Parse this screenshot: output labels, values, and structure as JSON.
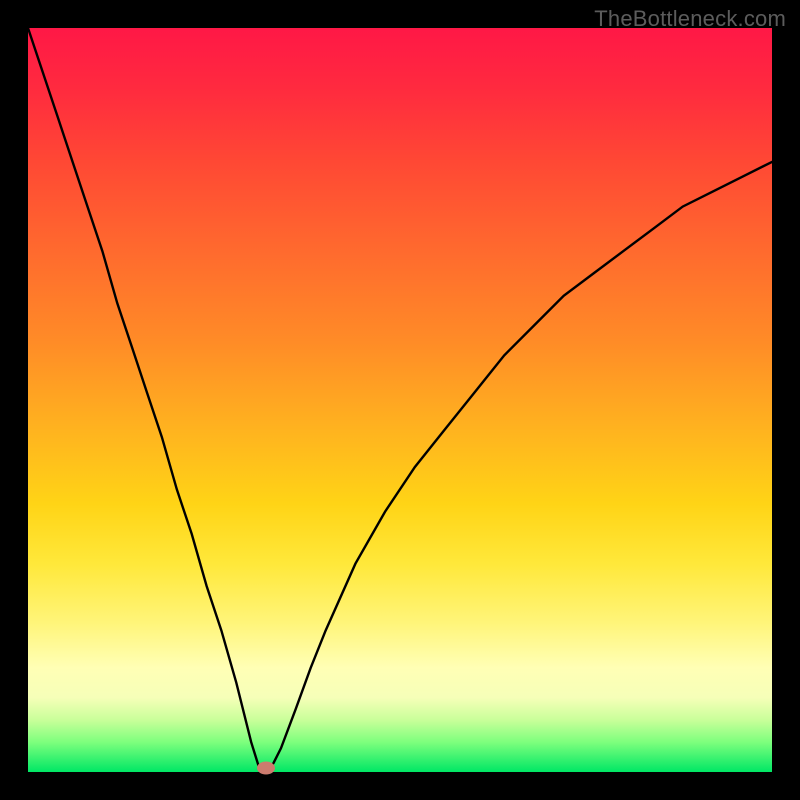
{
  "watermark": "TheBottleneck.com",
  "chart_data": {
    "type": "line",
    "title": "",
    "xlabel": "",
    "ylabel": "",
    "x": [
      0,
      2,
      4,
      6,
      8,
      10,
      12,
      14,
      16,
      18,
      20,
      22,
      24,
      26,
      28,
      30,
      31,
      32,
      33,
      34,
      36,
      38,
      40,
      44,
      48,
      52,
      56,
      60,
      64,
      68,
      72,
      76,
      80,
      84,
      88,
      92,
      96,
      100
    ],
    "values": [
      100,
      94,
      88,
      82,
      76,
      70,
      63,
      57,
      51,
      45,
      38,
      32,
      25,
      19,
      12,
      4,
      0.8,
      0,
      1.2,
      3.2,
      8.5,
      14,
      19,
      28,
      35,
      41,
      46,
      51,
      56,
      60,
      64,
      67,
      70,
      73,
      76,
      78,
      80,
      82
    ],
    "xlim": [
      0,
      100
    ],
    "ylim": [
      0,
      100
    ],
    "marker": {
      "x": 32,
      "y": 0.5,
      "color": "#cc7b6e"
    },
    "gradient_stops": [
      {
        "pct": 0,
        "color": "#ff1846"
      },
      {
        "pct": 50,
        "color": "#ffb31f"
      },
      {
        "pct": 80,
        "color": "#fff57a"
      },
      {
        "pct": 100,
        "color": "#00e765"
      }
    ]
  }
}
